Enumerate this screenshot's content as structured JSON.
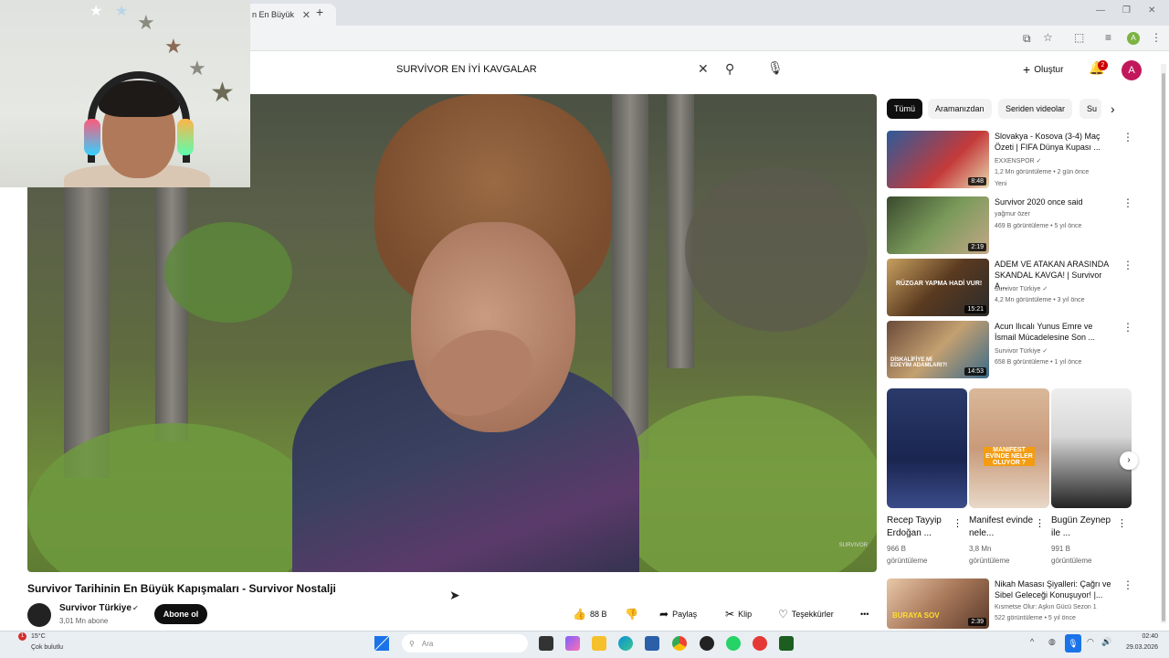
{
  "browser": {
    "tab_title": "n En Büyük",
    "tab_close": "✕",
    "new_tab": "+",
    "win_minimize": "—",
    "win_restore": "❐",
    "win_close": "✕",
    "profile_initial": "A"
  },
  "youtube_header": {
    "search_value": "SURVİVOR EN İYİ KAVGALAR",
    "create_label": "Oluştur",
    "notifications_count": "2",
    "avatar_initial": "A"
  },
  "player": {
    "watermark": "SURVIVOR"
  },
  "video": {
    "title": "Survivor Tarihinin En Büyük Kapışmaları - Survivor Nostalji",
    "channel": "Survivor Türkiye",
    "subscribers": "3,01 Mn abone",
    "subscribe_label": "Abone ol",
    "likes": "88 B",
    "share_label": "Paylaş",
    "clip_label": "Klip",
    "thanks_label": "Teşekkürler",
    "more_label": "•••"
  },
  "chips": [
    {
      "label": "Tümü"
    },
    {
      "label": "Aramanızdan"
    },
    {
      "label": "Seriden videolar"
    },
    {
      "label": "Su"
    }
  ],
  "recommendations": [
    {
      "title": "Slovakya - Kosova (3-4) Maç Özeti | FIFA Dünya Kupası ...",
      "channel": "EXXENSPOR ✓",
      "meta": "1,2 Mn görüntüleme • 2 gün önce",
      "extra": "Yeni",
      "duration": "8:48"
    },
    {
      "title": "Survivor 2020 once said",
      "channel": "yağmur özer",
      "meta": "469 B görüntüleme • 5 yıl önce",
      "extra": "",
      "duration": "2:19"
    },
    {
      "title": "ADEM VE ATAKAN ARASINDA SKANDAL KAVGA! | Survivor A...",
      "channel": "Survivor Türkiye ✓",
      "meta": "4,2 Mn görüntüleme • 3 yıl önce",
      "extra": "",
      "duration": "15:21"
    },
    {
      "title": "Acun Ilıcalı Yunus Emre ve İsmail Mücadelesine Son ...",
      "channel": "Survivor Türkiye ✓",
      "meta": "658 B görüntüleme • 1 yıl önce",
      "extra": "",
      "duration": "14:53"
    },
    {
      "title": "Nikah Masası Şiyalleri: Çağrı ve Sibel Geleceği Konuşuyor! |...",
      "channel": "Kısmetse Olur: Aşkın Gücü Sezon 1",
      "meta": "522 görüntüleme • 5 yıl önce",
      "extra": "",
      "duration": "2:39"
    }
  ],
  "thumb_texts": {
    "rec3_overlay": "RÜZGAR YAPMA HADİ VUR!",
    "rec4_overlay": "DİSKALİFİYE Mİ EDEYİM ADAMLARI?!",
    "rec5_overlay": "BURAYA SOV",
    "short2_overlay": "MANIFEST EVİNDE NELER OLUYOR ?"
  },
  "shorts": [
    {
      "title": "Recep Tayyip Erdoğan ...",
      "views": "966 B",
      "views_label": "görüntüleme"
    },
    {
      "title": "Manifest evinde nele...",
      "views": "3,8 Mn",
      "views_label": "görüntüleme"
    },
    {
      "title": "Bugün Zeynep ile ...",
      "views": "991 B",
      "views_label": "görüntüleme"
    }
  ],
  "taskbar": {
    "weather_temp": "15°C",
    "weather_desc": "Çok bulutlu",
    "weather_badge": "1",
    "search_placeholder": "Ara",
    "time": "02:40",
    "date": "29.03.2026"
  },
  "colors": {
    "youtube_red": "#cc0000",
    "chip_active": "#0f0f0f",
    "windows_blue": "#1a73e8"
  }
}
